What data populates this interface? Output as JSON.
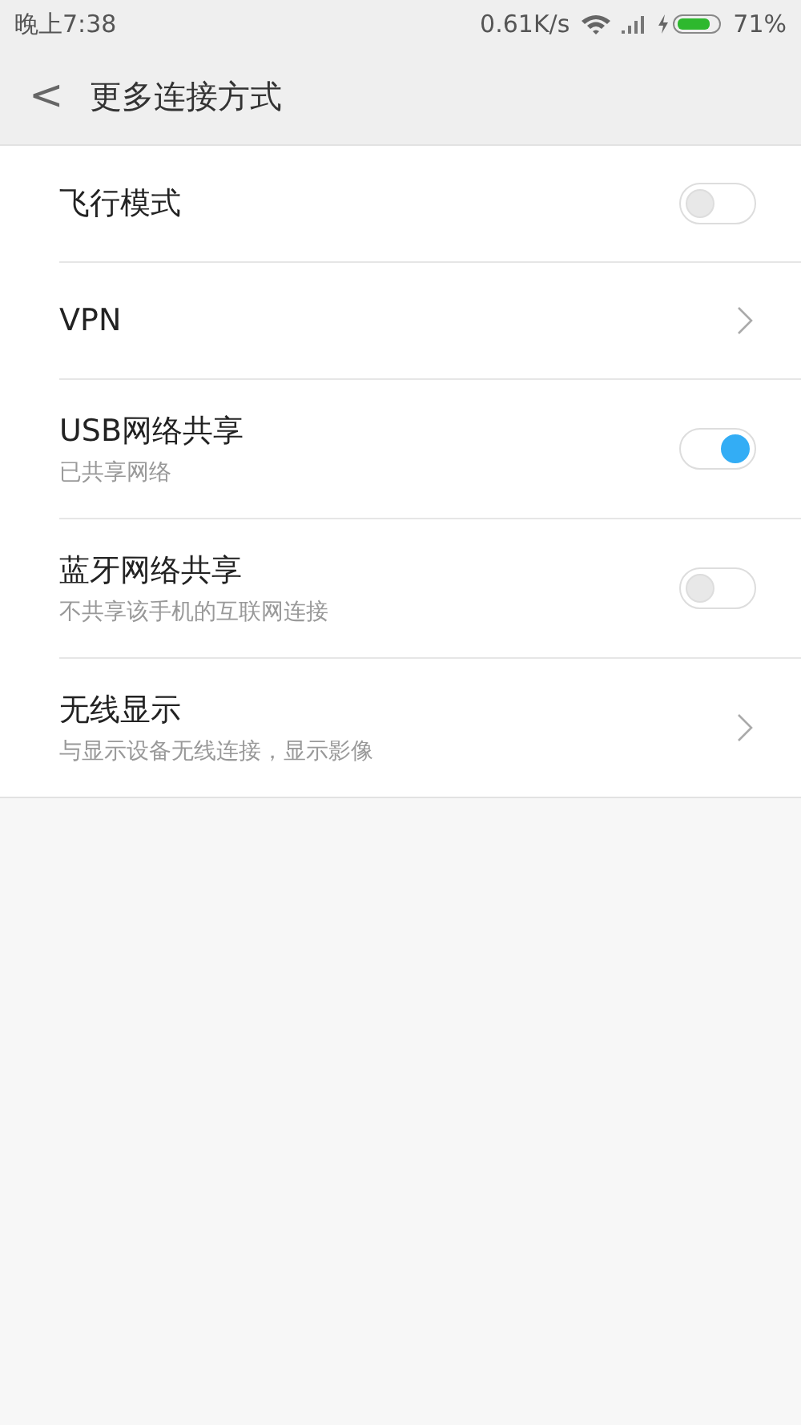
{
  "status_bar": {
    "time": "晚上7:38",
    "speed": "0.61K/s",
    "battery": "71%"
  },
  "header": {
    "back": "<",
    "title": "更多连接方式"
  },
  "items": [
    {
      "kind": "toggle",
      "title": "飞行模式",
      "on": false
    },
    {
      "kind": "link",
      "title": "VPN"
    },
    {
      "kind": "toggle",
      "title": "USB网络共享",
      "subtitle": "已共享网络",
      "on": true
    },
    {
      "kind": "toggle",
      "title": "蓝牙网络共享",
      "subtitle": "不共享该手机的互联网连接",
      "on": false
    },
    {
      "kind": "link",
      "title": "无线显示",
      "subtitle": "与显示设备无线连接，显示影像"
    }
  ]
}
